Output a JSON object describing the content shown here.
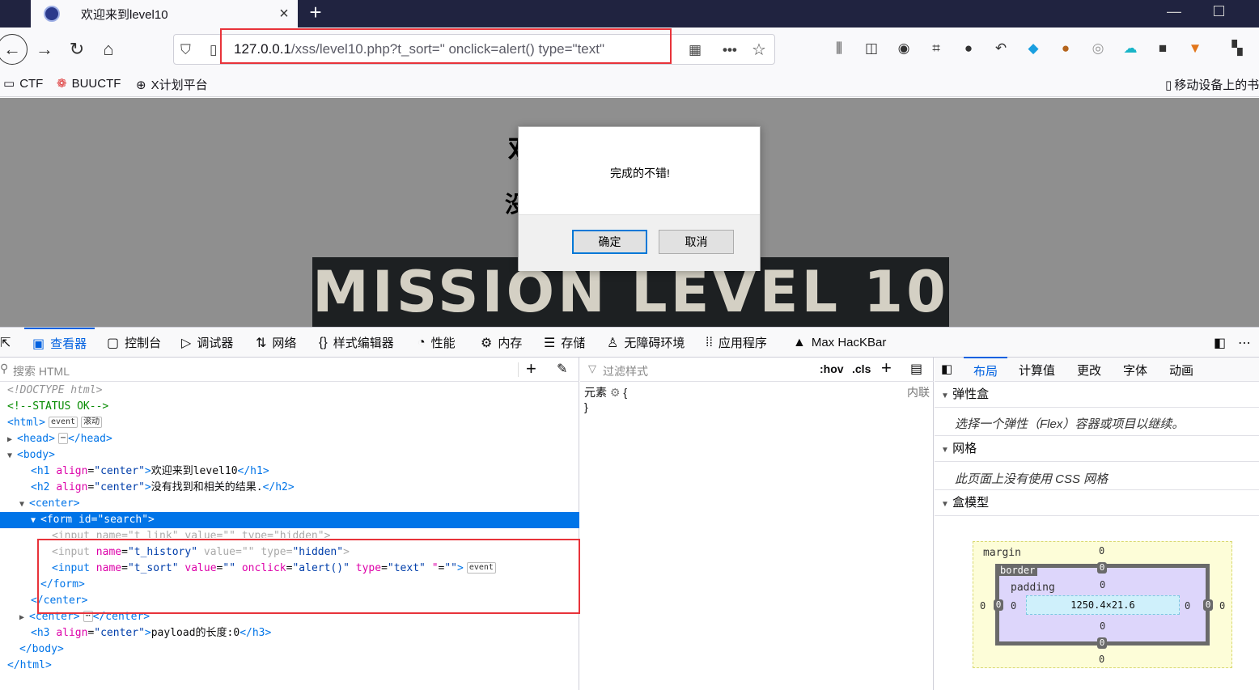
{
  "tab": {
    "title": "欢迎来到level10",
    "close": "×",
    "new": "+"
  },
  "nav": {
    "url_host": "127.0.0.1",
    "url_path": "/xss/level10.php?t_sort=\" onclick=alert() type=\"text\""
  },
  "bookmarks": [
    {
      "label": "CTF",
      "icon": "folder-icon"
    },
    {
      "label": "BUUCTF",
      "icon": "buuctf-icon"
    },
    {
      "label": "X计划平台",
      "icon": "globe-icon"
    },
    {
      "label": "移动设备上的书",
      "icon": "mobile-icon"
    }
  ],
  "page": {
    "h1": "欢",
    "h2": "没",
    "banner": "MISSION LEVEL 10"
  },
  "dialog": {
    "message": "完成的不错!",
    "ok": "确定",
    "cancel": "取消"
  },
  "devtools": {
    "tabs": [
      {
        "label": "查看器",
        "icon": "inspector-icon"
      },
      {
        "label": "控制台",
        "icon": "console-icon"
      },
      {
        "label": "调试器",
        "icon": "debugger-icon"
      },
      {
        "label": "网络",
        "icon": "network-icon"
      },
      {
        "label": "样式编辑器",
        "icon": "style-editor-icon"
      },
      {
        "label": "性能",
        "icon": "performance-icon"
      },
      {
        "label": "内存",
        "icon": "memory-icon"
      },
      {
        "label": "存储",
        "icon": "storage-icon"
      },
      {
        "label": "无障碍环境",
        "icon": "accessibility-icon"
      },
      {
        "label": "应用程序",
        "icon": "application-icon"
      },
      {
        "label": "Max HacKBar",
        "icon": "hackbar-icon"
      }
    ],
    "search_placeholder": "搜索 HTML",
    "filter_placeholder": "过滤样式",
    "hov": ":hov",
    "cls": ".cls",
    "element_rule": "元素",
    "inline": "内联",
    "brace_open": "{",
    "brace_close": "}"
  },
  "dom": {
    "doctype": "<!DOCTYPE html>",
    "comment": "<!--STATUS OK-->",
    "html_open": "<html>",
    "badge_event": "event",
    "badge_scroll": "滚动",
    "head": "<head>",
    "head_close": "</head>",
    "body_open": "<body>",
    "h1_text": "欢迎来到level10",
    "h2_text": "没有找到和相关的结果.",
    "center_open": "<center>",
    "form_line": "<form id=\"search\">",
    "input1_name": "t_link",
    "input1_value": "",
    "input1_type": "hidden",
    "input2_name": "t_history",
    "input2_value": "",
    "input2_type": "hidden",
    "input3_name": "t_sort",
    "input3_value": "",
    "input3_onclick": "alert()",
    "input3_type": "text",
    "form_close": "</form>",
    "center_close": "</center>",
    "h3_text": "payload的长度:0",
    "body_close": "</body>",
    "html_close": "</html>"
  },
  "layout_panel": {
    "tabs": [
      "布局",
      "计算值",
      "更改",
      "字体",
      "动画"
    ],
    "flex_title": "弹性盒",
    "flex_body": "选择一个弹性（Flex）容器或项目以继续。",
    "grid_title": "网格",
    "grid_body": "此页面上没有使用 CSS 网格",
    "box_title": "盒模型",
    "margin_label": "margin",
    "border_label": "border",
    "padding_label": "padding",
    "content_size": "1250.4×21.6",
    "zero": "0"
  }
}
